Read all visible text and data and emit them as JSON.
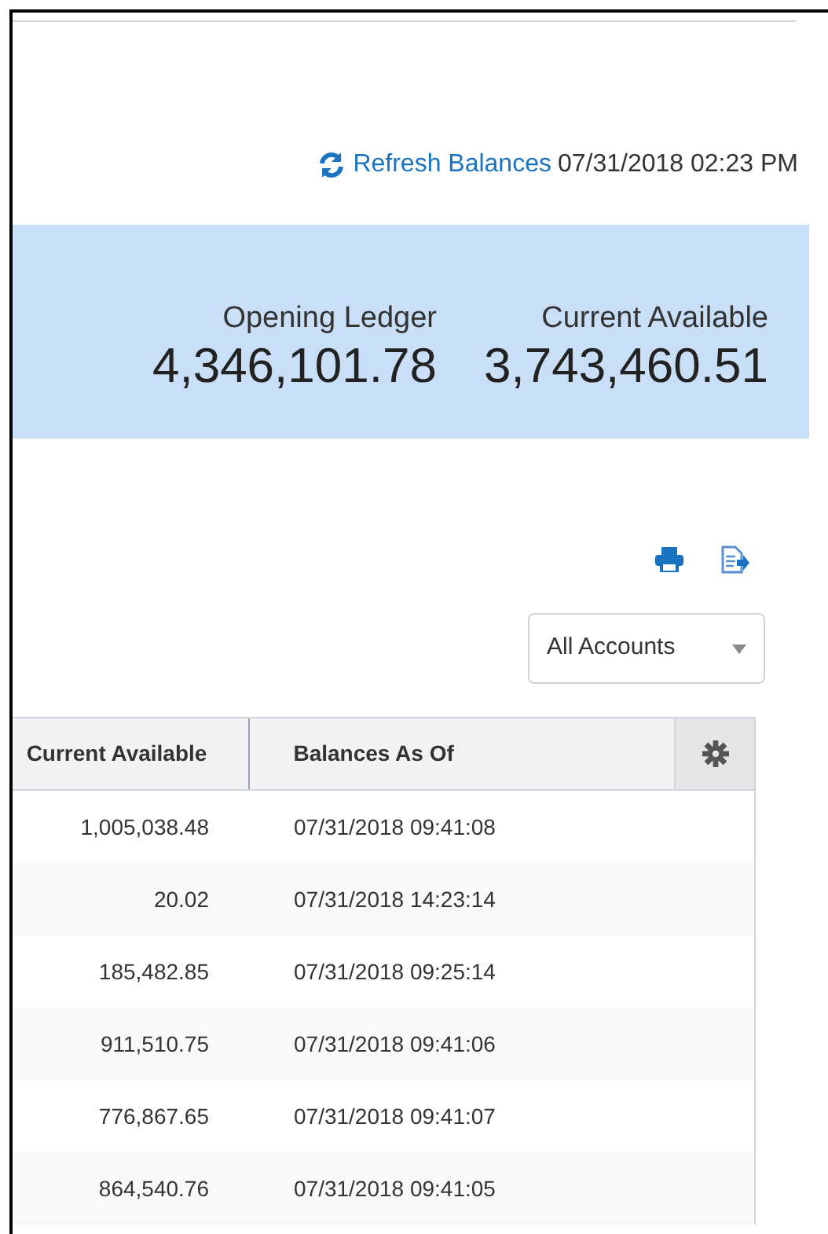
{
  "refresh": {
    "label": "Refresh Balances",
    "timestamp": "07/31/2018 02:23 PM"
  },
  "summary": [
    {
      "label": "Opening Ledger",
      "value": "4,346,101.78"
    },
    {
      "label": "Current Available",
      "value": "3,743,460.51"
    }
  ],
  "account_filter": {
    "value": "All Accounts"
  },
  "table": {
    "columns": [
      "Current Available",
      "Balances As Of"
    ],
    "rows": [
      [
        "1,005,038.48",
        "07/31/2018 09:41:08"
      ],
      [
        "20.02",
        "07/31/2018 14:23:14"
      ],
      [
        "185,482.85",
        "07/31/2018 09:25:14"
      ],
      [
        "911,510.75",
        "07/31/2018 09:41:06"
      ],
      [
        "776,867.65",
        "07/31/2018 09:41:07"
      ],
      [
        "864,540.76",
        "07/31/2018 09:41:05"
      ]
    ]
  }
}
